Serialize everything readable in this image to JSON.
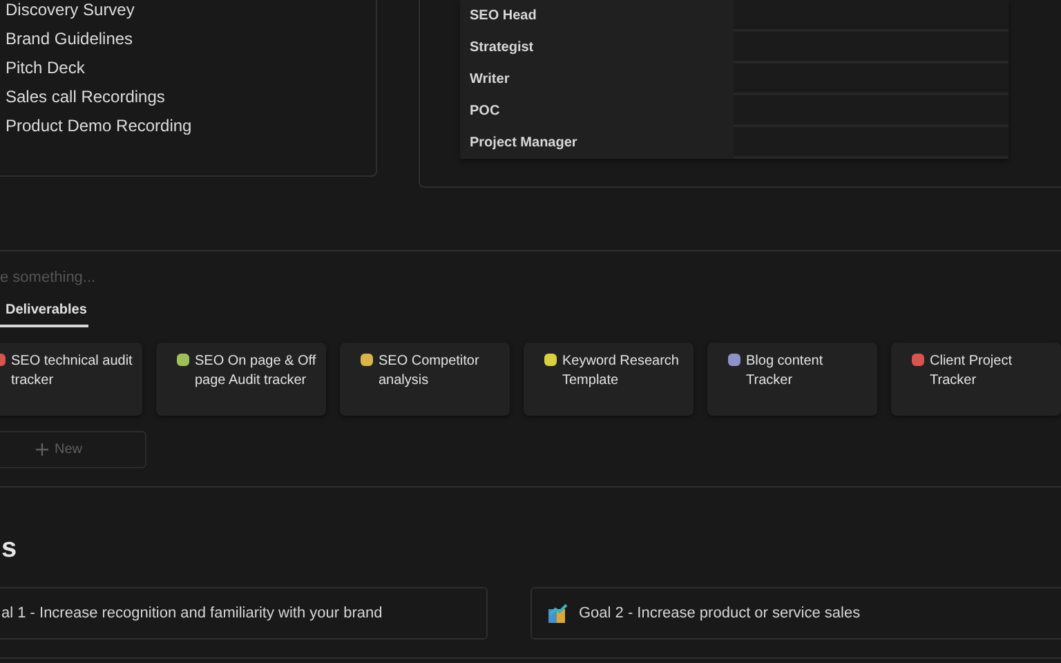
{
  "resources": {
    "items": [
      "Discovery Survey",
      "Brand Guidelines",
      "Pitch Deck",
      "Sales call Recordings",
      "Product Demo Recording"
    ]
  },
  "roles": {
    "rows": [
      {
        "label": "SEO Head"
      },
      {
        "label": "Strategist"
      },
      {
        "label": "Writer"
      },
      {
        "label": "POC"
      },
      {
        "label": "Project Manager"
      }
    ]
  },
  "database": {
    "search": {
      "placeholder": "e something..."
    },
    "tabs": [
      {
        "label": "Deliverables",
        "selected": true
      }
    ],
    "cards": [
      {
        "title": "SEO technical audit tracker",
        "color": "#d9534f"
      },
      {
        "title": "SEO On page & Off page Audit tracker",
        "color": "#9fbf5a"
      },
      {
        "title": "SEO Competitor analysis",
        "color": "#d8b44a"
      },
      {
        "title": "Keyword Research Template",
        "color": "#d8d040"
      },
      {
        "title": "Blog content Tracker",
        "color": "#8d93c9"
      },
      {
        "title": "Client Project Tracker",
        "color": "#d9534f"
      }
    ],
    "new_button": {
      "label": "New"
    }
  },
  "goals": {
    "heading": "s",
    "items": [
      {
        "title": "al 1 - Increase recognition and familiarity with your brand",
        "icon": false
      },
      {
        "title": "Goal 2 - Increase product or service sales",
        "icon": true
      }
    ]
  }
}
